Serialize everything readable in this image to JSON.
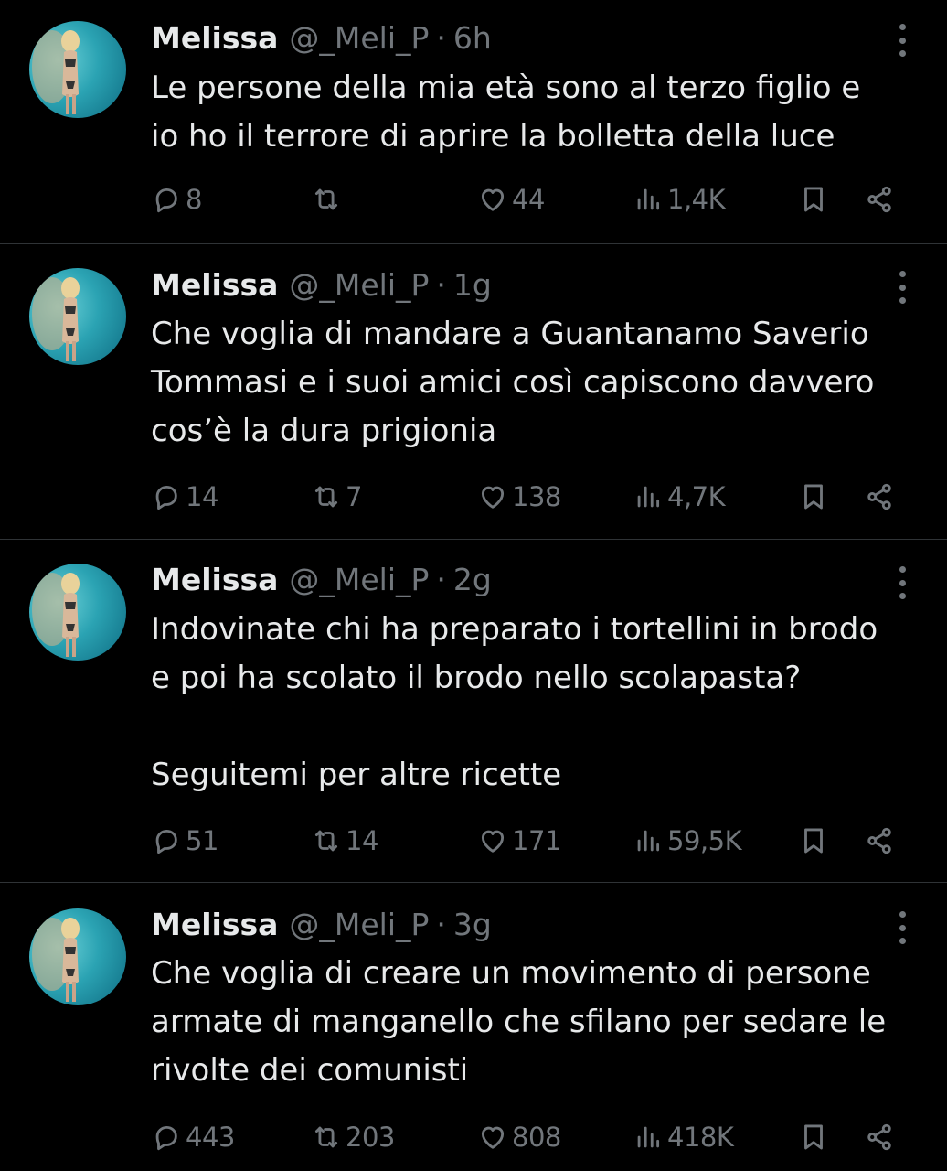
{
  "tweets": [
    {
      "name": "Melissa",
      "handle": "@_Meli_P",
      "separator": "·",
      "time": "6h",
      "text": "Le persone della mia età sono al terzo figlio e\nio ho il terrore di aprire la bolletta della luce",
      "replies": "8",
      "retweets": "",
      "likes": "44",
      "views": "1,4K"
    },
    {
      "name": "Melissa",
      "handle": "@_Meli_P",
      "separator": "·",
      "time": "1g",
      "text": "Che voglia di mandare a Guantanamo Saverio\nTommasi e i suoi amici così capiscono davvero\ncos’è la dura prigionia",
      "replies": "14",
      "retweets": "7",
      "likes": "138",
      "views": "4,7K"
    },
    {
      "name": "Melissa",
      "handle": "@_Meli_P",
      "separator": "·",
      "time": "2g",
      "text": "Indovinate chi ha preparato i tortellini in brodo\ne poi ha scolato il brodo nello scolapasta?\n\nSeguitemi per altre ricette",
      "replies": "51",
      "retweets": "14",
      "likes": "171",
      "views": "59,5K"
    },
    {
      "name": "Melissa",
      "handle": "@_Meli_P",
      "separator": "·",
      "time": "3g",
      "text": "Che voglia di creare un movimento di persone\narmate di manganello che sfilano per sedare le\nrivolte dei comunisti",
      "replies": "443",
      "retweets": "203",
      "likes": "808",
      "views": "418K"
    }
  ],
  "icons": {
    "reply": "reply-icon",
    "retweet": "retweet-icon",
    "like": "heart-icon",
    "views": "views-icon",
    "bookmark": "bookmark-icon",
    "share": "share-icon",
    "more": "more-icon"
  },
  "colors": {
    "background": "#000000",
    "primary_text": "#e7e9ea",
    "secondary_text": "#71767b",
    "divider": "#2f3336"
  }
}
